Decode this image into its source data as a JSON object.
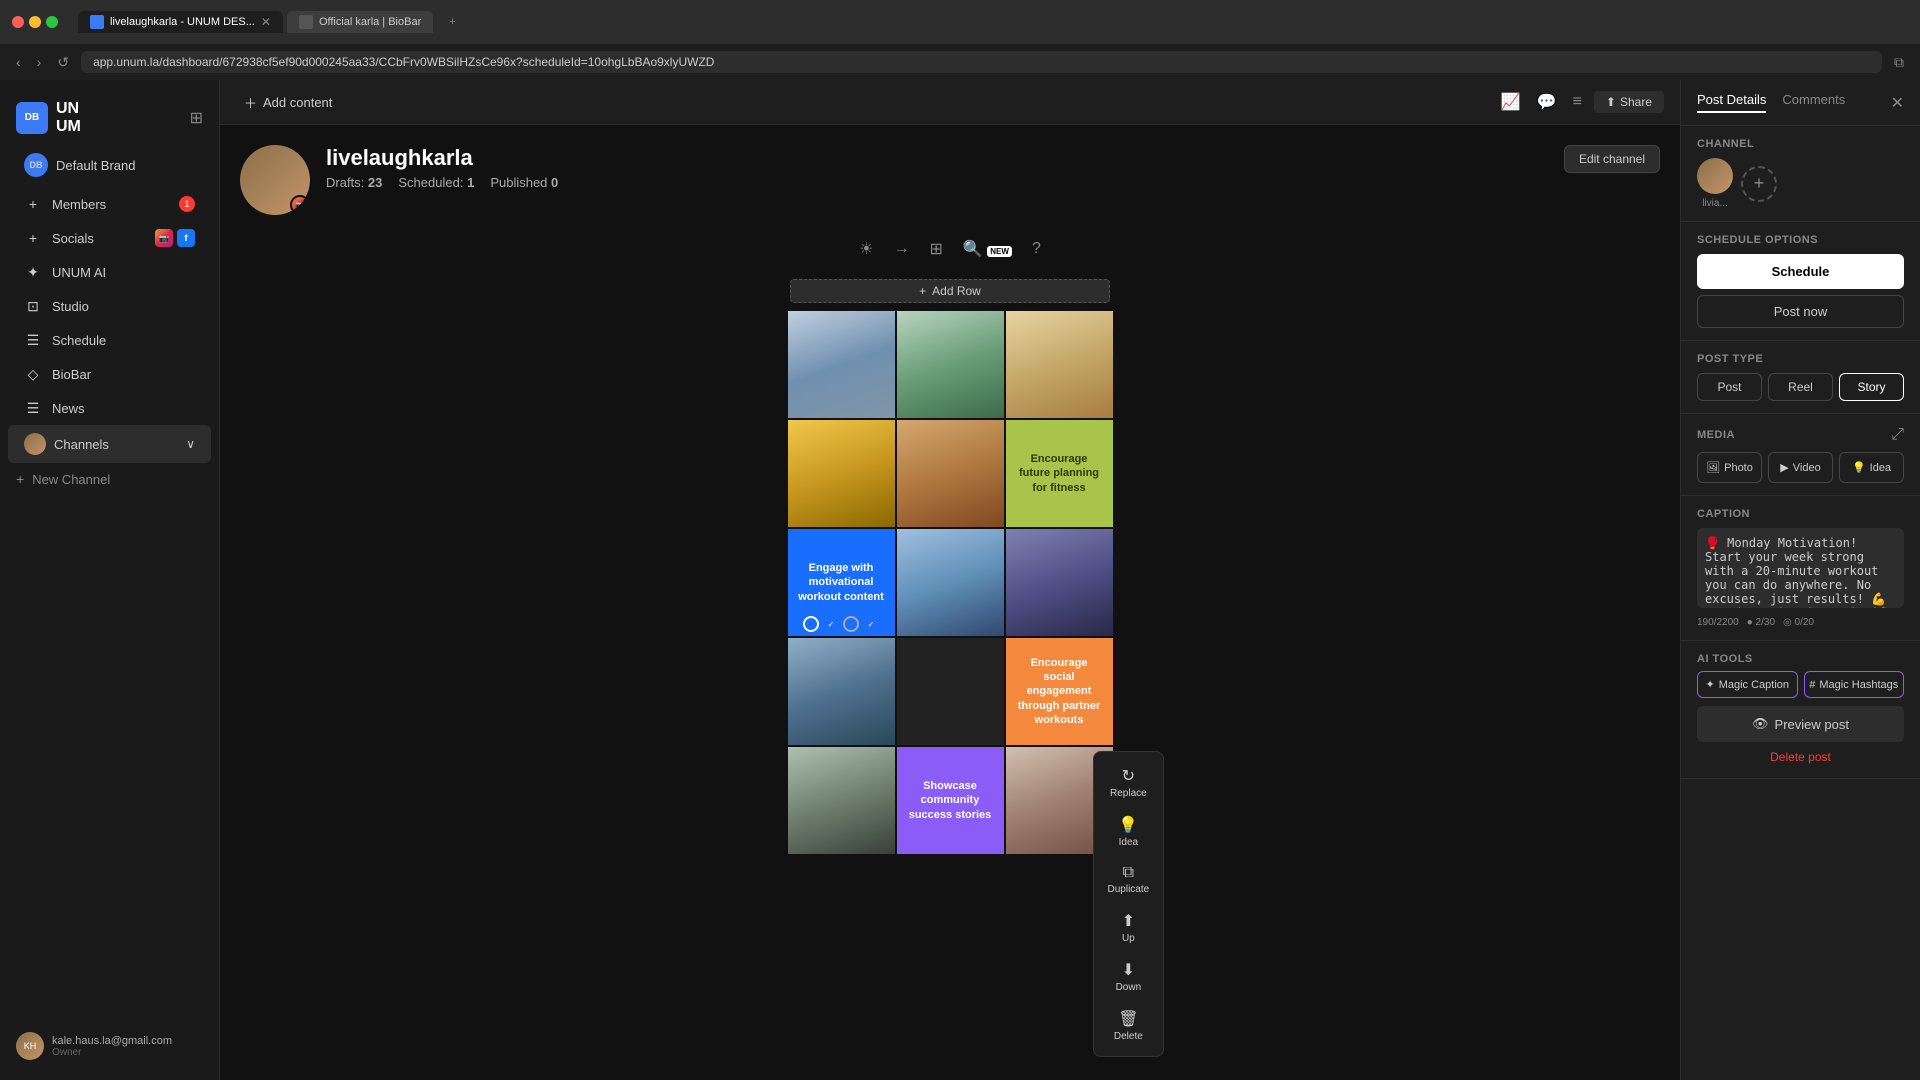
{
  "browser": {
    "tabs": [
      {
        "label": "livelaughkarla - UNUM DES...",
        "active": true,
        "icon": "unum"
      },
      {
        "label": "Official karla | BioBar",
        "active": false,
        "icon": "biobar"
      }
    ],
    "url": "app.unum.la/dashboard/672938cf5ef90d000245aa33/CCbFrv0WBSilHZsCe96x?scheduleId=10ohgLbBAo9xlyUWZD"
  },
  "sidebar": {
    "logo": "UN\nUM",
    "brand": "Default Brand",
    "members_label": "Members",
    "members_badge": "1",
    "socials_label": "Socials",
    "unum_ai_label": "UNUM AI",
    "studio_label": "Studio",
    "schedule_label": "Schedule",
    "biobar_label": "BioBar",
    "news_label": "News",
    "channels_label": "Channels",
    "new_channel_label": "New Channel",
    "user_email": "kale.haus.la@gmail.com",
    "user_role": "Owner"
  },
  "toolbar": {
    "add_content_label": "Add content",
    "share_label": "Share"
  },
  "profile": {
    "username": "livelaughkarla",
    "drafts_label": "Drafts:",
    "drafts_count": "23",
    "scheduled_label": "Scheduled:",
    "scheduled_count": "1",
    "published_label": "Published",
    "published_count": "0",
    "edit_channel_label": "Edit channel"
  },
  "grid": {
    "add_row_label": "Add Row",
    "cells": [
      {
        "type": "image",
        "style": "img-runner"
      },
      {
        "type": "image",
        "style": "img-hand"
      },
      {
        "type": "image",
        "style": "img-tan"
      },
      {
        "type": "image",
        "style": "img-yellow"
      },
      {
        "type": "image",
        "style": "img-wood"
      },
      {
        "type": "text",
        "style": "cell-green",
        "text": "Encourage future planning for fitness"
      },
      {
        "type": "text",
        "style": "cell-blue",
        "text": "Engage with motivational workout content",
        "selected": true
      },
      {
        "type": "image",
        "style": "img-run2"
      },
      {
        "type": "image",
        "style": "img-athlete"
      },
      {
        "type": "image",
        "style": "img-cyclist"
      },
      {
        "type": "image",
        "style": "img-dark"
      },
      {
        "type": "text",
        "style": "cell-orange",
        "text": "Encourage social engagement through partner workouts"
      },
      {
        "type": "image",
        "style": "img-group"
      },
      {
        "type": "text",
        "style": "cell-purple",
        "text": "Showcase community success stories"
      },
      {
        "type": "image",
        "style": "img-runner2"
      }
    ],
    "context_menu": {
      "replace_label": "Replace",
      "idea_label": "Idea",
      "duplicate_label": "Duplicate",
      "up_label": "Up",
      "down_label": "Down",
      "delete_label": "Delete"
    }
  },
  "right_panel": {
    "post_details_tab": "Post Details",
    "comments_tab": "Comments",
    "channel_label": "Channel",
    "channel_name": "livia...",
    "schedule_options_label": "Schedule options",
    "schedule_btn_label": "Schedule",
    "post_now_btn_label": "Post now",
    "post_type_label": "Post Type",
    "post_types": [
      "Post",
      "Reel",
      "Story"
    ],
    "active_post_type": "Story",
    "media_label": "Media",
    "media_types": [
      "Photo",
      "Video",
      "Idea"
    ],
    "caption_label": "Caption",
    "caption_text": "🥊 Monday Motivation! Start your week strong with a 20-minute workout you can do anywhere. No excuses, just results! 💪 #MondayMotivation #FitLife",
    "caption_meta": {
      "chars": "190/2200",
      "hashtags": "● 2/30",
      "mentions": "◎ 0/20"
    },
    "ai_tools_label": "AI TOOLS",
    "magic_caption_label": "Magic Caption",
    "magic_hashtags_label": "Magic Hashtags",
    "preview_post_label": "Preview post",
    "delete_post_label": "Delete post"
  }
}
